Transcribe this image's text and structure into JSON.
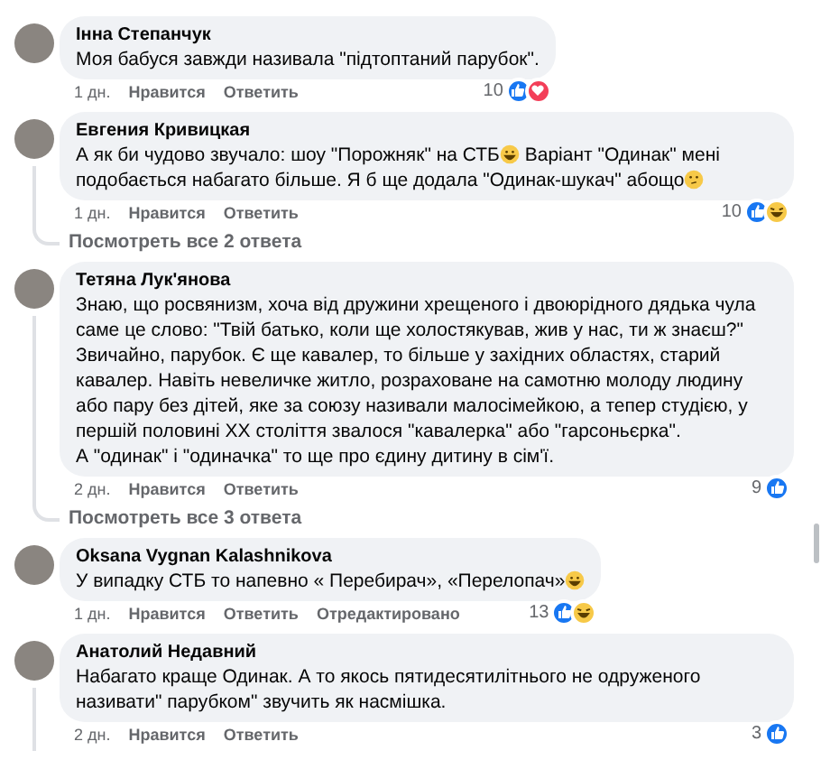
{
  "items": [
    {
      "kind": "comment",
      "author": "Інна Степанчук",
      "thread_line": false,
      "body": [
        {
          "kind": "text",
          "text": "Моя бабуся завжди називала \"підтоптаний парубок\"."
        }
      ],
      "time": "1 дн.",
      "like": "Нравится",
      "reply": "Ответить",
      "reaction_count": "10",
      "reactions": [
        {
          "kind": "like"
        },
        {
          "kind": "love"
        }
      ]
    },
    {
      "kind": "comment",
      "author": "Евгения Кривицкая",
      "thread_line": true,
      "body": [
        {
          "kind": "text",
          "text": "А як би чудово звучало: шоу \"Порожняк\" на СТБ"
        },
        {
          "kind": "laughing"
        },
        {
          "kind": "text",
          "text": " Варіант \"Одинак\" мені подобається набагато більше. Я б ще додала \"Одинак-шукач\" абощо"
        },
        {
          "kind": "thinking"
        }
      ],
      "time": "1 дн.",
      "like": "Нравится",
      "reply": "Ответить",
      "reaction_count": "10",
      "reactions": [
        {
          "kind": "like"
        },
        {
          "kind": "haha"
        }
      ]
    },
    {
      "kind": "replies",
      "label": "Посмотреть все 2 ответа"
    },
    {
      "kind": "comment",
      "author": "Тетяна Лук'янова",
      "thread_line": true,
      "body": [
        {
          "kind": "text",
          "text": "Знаю, що росвянизм, хоча від дружини хрещеного і двоюрідного дядька чула саме це слово: \"Твій батько, коли ще холостякував, жив у нас, ти ж знаєш?\" Звичайно, парубок. Є ще кавалер, то більше у західних областях, старий кавалер. Навіть невеличке житло, розраховане на самотню молоду людину або пару без дітей, яке за союзу називали малосімейкою, а тепер студією, у першій половині XX століття звалося \"кавалерка\" або \"гарсоньєрка\".\nА \"одинак\" і \"одиначка\" то ще про єдину дитину в сім'ї."
        }
      ],
      "time": "2 дн.",
      "like": "Нравится",
      "reply": "Ответить",
      "reaction_count": "9",
      "reactions": [
        {
          "kind": "like"
        }
      ]
    },
    {
      "kind": "replies",
      "label": "Посмотреть все 3 ответа"
    },
    {
      "kind": "comment",
      "author": "Oksana Vygnan Kalashnikova",
      "thread_line": false,
      "body": [
        {
          "kind": "text",
          "text": "У випадку СТБ то напевно « Перебирач», «Перелопач»"
        },
        {
          "kind": "laughing"
        }
      ],
      "time": "1 дн.",
      "like": "Нравится",
      "reply": "Ответить",
      "edited": "Отредактировано",
      "reaction_count": "13",
      "reactions": [
        {
          "kind": "like"
        },
        {
          "kind": "haha"
        }
      ]
    },
    {
      "kind": "comment",
      "author": "Анатолий Недавний",
      "thread_line": true,
      "body": [
        {
          "kind": "text",
          "text": "Набагато краще Одинак. А то якось пятидесятилітнього не одруженого називати\" парубком\" звучить як насмішка."
        }
      ],
      "time": "2 дн.",
      "like": "Нравится",
      "reply": "Ответить",
      "reaction_count": "3",
      "reactions": [
        {
          "kind": "like"
        }
      ]
    }
  ]
}
